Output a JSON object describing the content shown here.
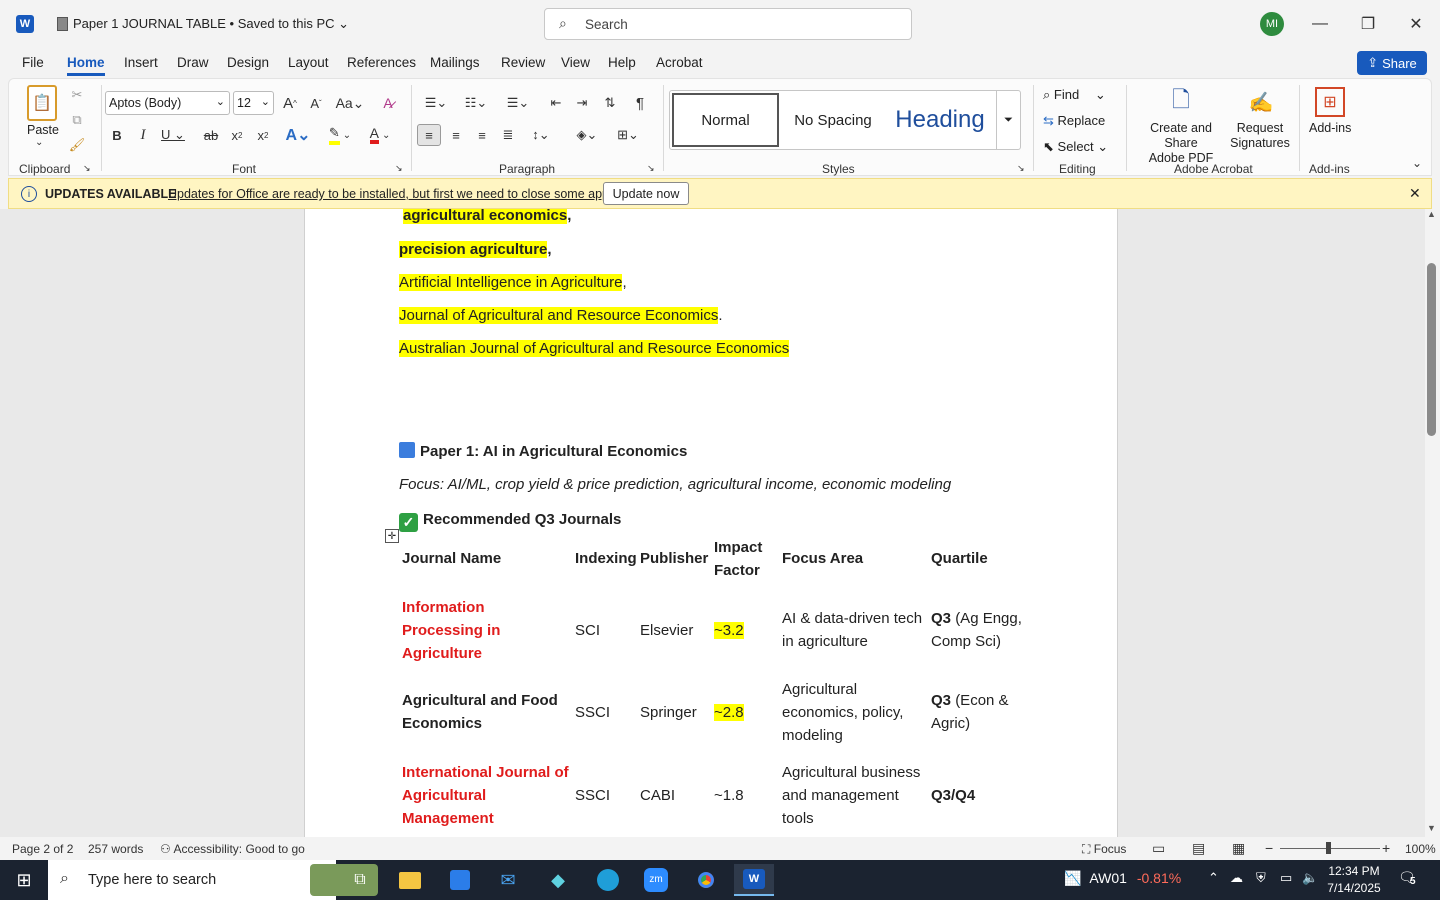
{
  "titlebar": {
    "doc_title": "Paper 1 JOURNAL TABLE",
    "save_status": "Saved to this PC",
    "search_placeholder": "Search",
    "avatar": "MI"
  },
  "menu": {
    "items": [
      "File",
      "Home",
      "Insert",
      "Draw",
      "Design",
      "Layout",
      "References",
      "Mailings",
      "Review",
      "View",
      "Help",
      "Acrobat"
    ],
    "share": "Share"
  },
  "ribbon": {
    "paste": "Paste",
    "font_name": "Aptos (Body)",
    "font_size": "12",
    "groups": {
      "clipboard": "Clipboard",
      "font": "Font",
      "paragraph": "Paragraph",
      "styles": "Styles",
      "editing": "Editing",
      "acrobat": "Adobe Acrobat",
      "addins": "Add-ins"
    },
    "styles": {
      "normal": "Normal",
      "nospacing": "No Spacing",
      "heading": "Heading"
    },
    "editing": {
      "find": "Find",
      "replace": "Replace",
      "select": "Select"
    },
    "acrobat": {
      "create1": "Create and Share",
      "create2": "Adobe PDF",
      "request1": "Request",
      "request2": "Signatures"
    },
    "addins": "Add-ins"
  },
  "notice": {
    "label": "UPDATES AVAILABLE",
    "message": "Updates for Office are ready to be installed, but first we need to close some apps.",
    "button": "Update now"
  },
  "doc": {
    "partial": "agricultural economics",
    "lines": [
      "precision agriculture",
      "Artificial Intelligence in Agriculture",
      "Journal of Agricultural and Resource Economics",
      "Australian Journal of Agricultural and Resource Economics"
    ],
    "heading": "Paper 1: AI in Agricultural Economics",
    "focus": "Focus: AI/ML, crop yield & price prediction, agricultural income, economic modeling",
    "recommended": "Recommended Q3 Journals",
    "table": {
      "headers": [
        "Journal Name",
        "Indexing",
        "Publisher",
        "Impact Factor",
        "Focus Area",
        "Quartile"
      ],
      "rows": [
        {
          "name": "Information Processing in Agriculture",
          "indexing": "SCI",
          "publisher": "Elsevier",
          "impact": "~3.2",
          "focus": "AI & data-driven tech in agriculture",
          "q": "Q3",
          "qnote": "(Ag Engg, Comp Sci)"
        },
        {
          "name": "Agricultural and Food Economics",
          "indexing": "SSCI",
          "publisher": "Springer",
          "impact": "~2.8",
          "focus": "Agricultural economics, policy, modeling",
          "q": "Q3",
          "qnote": "(Econ & Agric)"
        },
        {
          "name": "International Journal of Agricultural Management",
          "indexing": "SSCI",
          "publisher": "CABI",
          "impact": "~1.8",
          "focus": "Agricultural business and management tools",
          "q": "Q3/Q4",
          "qnote": ""
        }
      ]
    }
  },
  "status": {
    "page": "Page 2 of 2",
    "words": "257 words",
    "accessibility": "Accessibility: Good to go",
    "focus": "Focus",
    "zoom": "100%"
  },
  "taskbar": {
    "search": "Type here to search",
    "stock_name": "AW01",
    "stock_change": "-0.81%",
    "time": "12:34 PM",
    "date": "7/14/2025",
    "notif": "5"
  }
}
